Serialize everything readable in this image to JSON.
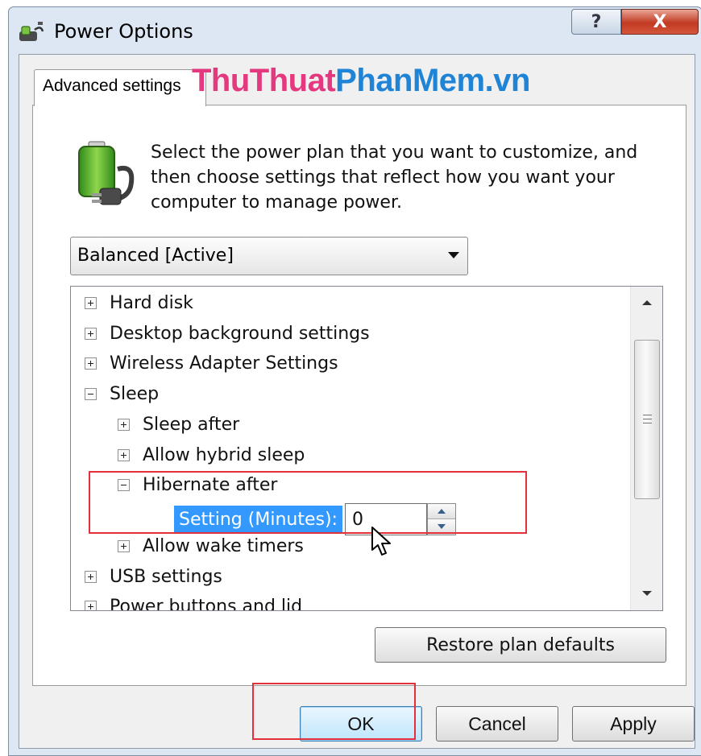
{
  "window": {
    "title": "Power Options",
    "help_icon": "?",
    "close_icon": "X",
    "icons": {
      "app": "power-options-icon",
      "help": "help-icon",
      "close": "close-icon"
    }
  },
  "tab": {
    "label": "Advanced settings"
  },
  "watermark": {
    "part1": "ThuThuat",
    "part2": "PhanMem.vn"
  },
  "description": "Select the power plan that you want to customize, and then choose settings that reflect how you want your computer to manage power.",
  "plan_select": {
    "value": "Balanced [Active]"
  },
  "tree": {
    "items": [
      {
        "label": "Hard disk",
        "state": "collapsed"
      },
      {
        "label": "Desktop background settings",
        "state": "collapsed"
      },
      {
        "label": "Wireless Adapter Settings",
        "state": "collapsed"
      },
      {
        "label": "Sleep",
        "state": "expanded"
      },
      {
        "label": "Sleep after",
        "state": "collapsed"
      },
      {
        "label": "Allow hybrid sleep",
        "state": "collapsed"
      },
      {
        "label": "Hibernate after",
        "state": "expanded"
      },
      {
        "label": "Allow wake timers",
        "state": "collapsed"
      },
      {
        "label": "USB settings",
        "state": "collapsed"
      },
      {
        "label": "Power buttons and lid",
        "state": "collapsed"
      }
    ],
    "setting": {
      "label": "Setting (Minutes):",
      "value": "0"
    }
  },
  "buttons": {
    "restore": "Restore plan defaults",
    "ok": "OK",
    "cancel": "Cancel",
    "apply": "Apply"
  },
  "colors": {
    "accent_highlight": "#e3303a",
    "selection": "#3399ff",
    "watermark_pink": "#e5397f",
    "watermark_blue": "#1f84d6"
  }
}
